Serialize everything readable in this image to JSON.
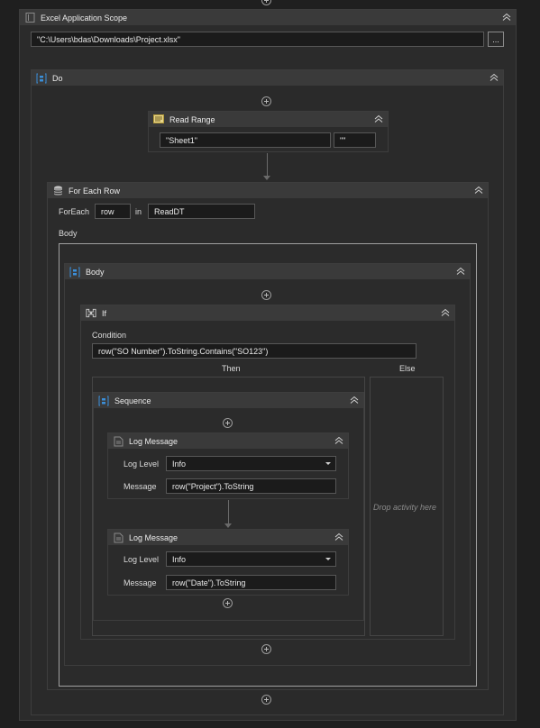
{
  "scope": {
    "title": "Excel Application Scope",
    "path": "\"C:\\Users\\bdas\\Downloads\\Project.xlsx\"",
    "browse_label": "..."
  },
  "do": {
    "title": "Do"
  },
  "read_range": {
    "title": "Read Range",
    "sheet": "\"Sheet1\"",
    "range": "\"\""
  },
  "for_each_row": {
    "title": "For Each Row",
    "foreach_label": "ForEach",
    "item": "row",
    "in_label": "in",
    "collection": "ReadDT",
    "body_label": "Body"
  },
  "body": {
    "title": "Body"
  },
  "if": {
    "title": "If",
    "condition_label": "Condition",
    "condition": "row(\"SO Number\").ToString.Contains(\"SO123\")",
    "then_label": "Then",
    "else_label": "Else",
    "else_placeholder": "Drop activity here"
  },
  "sequence": {
    "title": "Sequence"
  },
  "log1": {
    "title": "Log Message",
    "level_label": "Log Level",
    "level": "Info",
    "message_label": "Message",
    "message": "row(\"Project\").ToString"
  },
  "log2": {
    "title": "Log Message",
    "level_label": "Log Level",
    "level": "Info",
    "message_label": "Message",
    "message": "row(\"Date\").ToString"
  },
  "colors": {
    "background": "#1f1f1f",
    "panel": "#2b2b2b",
    "header": "#3a3a3a",
    "accent": "#3b8fd9",
    "note": "#e8d58a"
  }
}
